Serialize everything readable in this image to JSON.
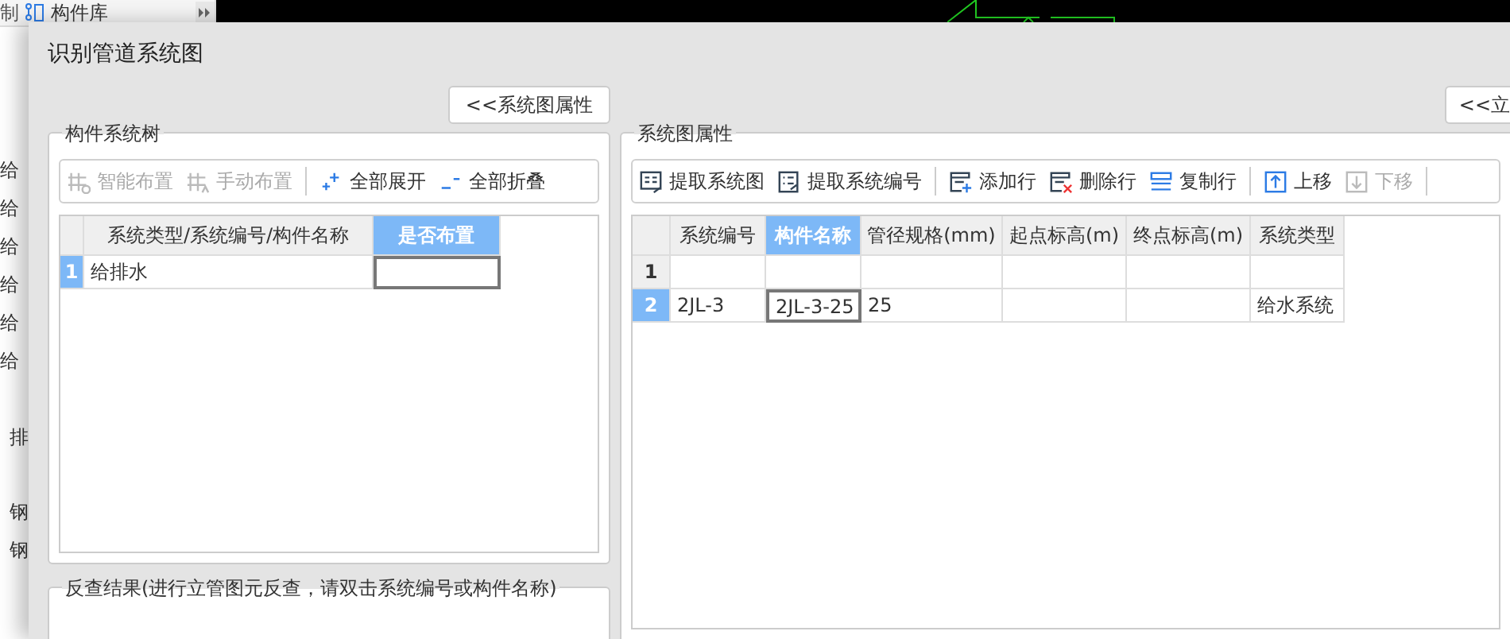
{
  "background_app": {
    "tabs": [
      {
        "label": "制",
        "selected": false
      },
      {
        "label": "构件库",
        "selected": true
      }
    ],
    "list_items": [
      "给",
      "给",
      "给",
      "给",
      "给",
      "给",
      "排",
      "钢",
      "钢"
    ]
  },
  "dialog": {
    "title": "识别管道系统图",
    "left_toggle": "<<系统图属性",
    "right_toggle": "<<立",
    "tree_panel": {
      "title": "构件系统树",
      "toolbar": [
        {
          "kind": "button",
          "label": "智能布置",
          "disabled": true
        },
        {
          "kind": "button",
          "label": "手动布置",
          "disabled": true
        },
        {
          "kind": "separator"
        },
        {
          "kind": "button",
          "label": "全部展开",
          "disabled": false
        },
        {
          "kind": "button",
          "label": "全部折叠",
          "disabled": false
        }
      ],
      "table": {
        "columns": [
          {
            "label": "系统类型/系统编号/构件名称",
            "selected": false
          },
          {
            "label": "是否布置",
            "selected": true
          }
        ],
        "rows": [
          {
            "number": "1",
            "selected": true,
            "cells": [
              "给排水",
              ""
            ]
          }
        ]
      }
    },
    "lookup_panel": {
      "title": "反查结果(进行立管图元反查，请双击系统编号或构件名称)"
    },
    "props_panel": {
      "title": "系统图属性",
      "toolbar": [
        {
          "kind": "button",
          "label": "提取系统图",
          "disabled": false
        },
        {
          "kind": "button",
          "label": "提取系统编号",
          "disabled": false
        },
        {
          "kind": "separator"
        },
        {
          "kind": "button",
          "label": "添加行",
          "disabled": false
        },
        {
          "kind": "button",
          "label": "删除行",
          "disabled": false
        },
        {
          "kind": "button",
          "label": "复制行",
          "disabled": false
        },
        {
          "kind": "separator"
        },
        {
          "kind": "button",
          "label": "上移",
          "disabled": false
        },
        {
          "kind": "button",
          "label": "下移",
          "disabled": true
        },
        {
          "kind": "separator"
        }
      ],
      "table": {
        "columns": [
          {
            "label": "系统编号",
            "selected": false
          },
          {
            "label": "构件名称",
            "selected": true
          },
          {
            "label": "管径规格(mm)",
            "selected": false
          },
          {
            "label": "起点标高(m)",
            "selected": false
          },
          {
            "label": "终点标高(m)",
            "selected": false
          },
          {
            "label": "系统类型",
            "selected": false
          }
        ],
        "rows": [
          {
            "number": "1",
            "selected": false,
            "cells": [
              "",
              "",
              "",
              "",
              "",
              ""
            ]
          },
          {
            "number": "2",
            "selected": true,
            "cells": [
              "2JL-3",
              "2JL-3-25",
              "25",
              "",
              "",
              "给水系统"
            ]
          }
        ]
      }
    }
  }
}
